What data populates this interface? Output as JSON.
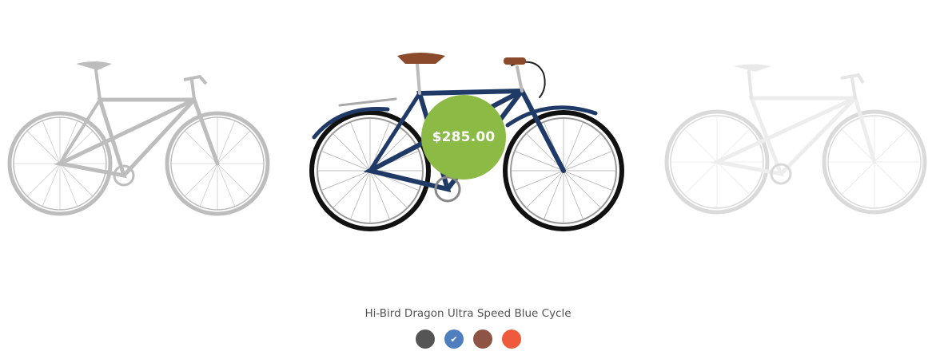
{
  "product": {
    "name": "Hi-Bird Dragon Ultra Speed Blue Cycle",
    "price": "$285.00",
    "badge_color": "#8bbb45"
  },
  "carousel": {
    "items": [
      {
        "name": "grey-fixie-bike",
        "frame_color": "#7a7a7a",
        "state": "faded"
      },
      {
        "name": "blue-city-bike",
        "frame_color": "#1f3a66",
        "state": "active"
      },
      {
        "name": "white-fixie-bike",
        "frame_color": "#e6e6e6",
        "state": "faded"
      }
    ]
  },
  "swatches": [
    {
      "name": "dark-grey",
      "color": "#555555",
      "selected": false
    },
    {
      "name": "blue",
      "color": "#4f7fbf",
      "selected": true,
      "check_icon": "✔"
    },
    {
      "name": "brown",
      "color": "#8e5444",
      "selected": false
    },
    {
      "name": "orange-red",
      "color": "#f05a3c",
      "selected": false
    }
  ]
}
